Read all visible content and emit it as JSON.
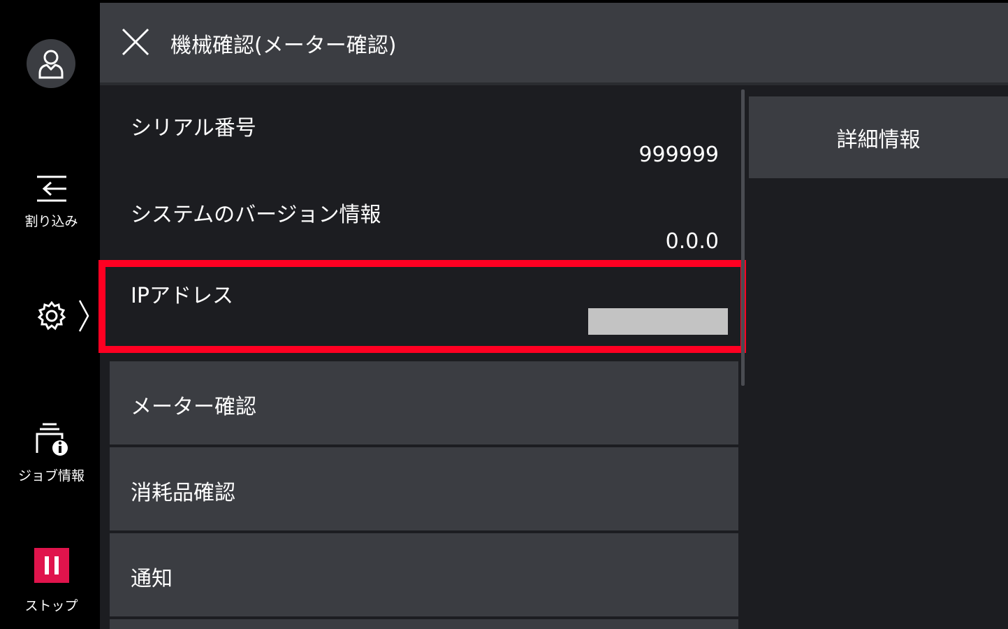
{
  "header": {
    "title": "機械確認(メーター確認)"
  },
  "rail": {
    "interrupt_label": "割り込み",
    "job_info_label": "ジョブ情報",
    "stop_label": "ストップ",
    "stop_color": "#e0144c"
  },
  "info": [
    {
      "label": "シリアル番号",
      "value": "999999"
    },
    {
      "label": "システムのバージョン情報",
      "value": "0.0.0"
    },
    {
      "label": "IPアドレス",
      "value": ""
    }
  ],
  "menu": [
    {
      "label": "メーター確認"
    },
    {
      "label": "消耗品確認"
    },
    {
      "label": "通知"
    }
  ],
  "right": {
    "detail_label": "詳細情報"
  },
  "colors": {
    "highlight": "#ff0022",
    "panel": "#3b3d42",
    "background": "#1c1d21"
  },
  "icons": [
    "user-icon",
    "interrupt-icon",
    "gear-icon",
    "chevron-right-icon",
    "job-info-icon",
    "stop-icon",
    "close-icon"
  ]
}
